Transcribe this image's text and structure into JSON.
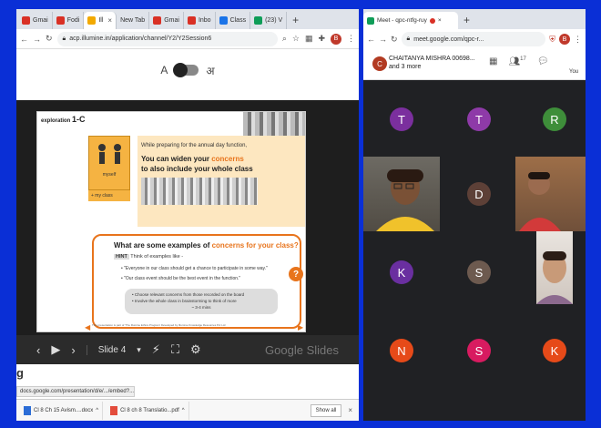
{
  "left_window": {
    "tabs": [
      {
        "label": "Gmai",
        "color": "#d93025"
      },
      {
        "label": "Fodi",
        "color": "#d93025"
      },
      {
        "label": "Ill",
        "color": "#f2a900"
      },
      {
        "label": "New Tab",
        "color": ""
      },
      {
        "label": "Gmai",
        "color": "#d93025"
      },
      {
        "label": "Inbo",
        "color": "#d93025"
      },
      {
        "label": "Class",
        "color": "#1a73e8"
      },
      {
        "label": "(23) V",
        "color": "#0f9d58"
      }
    ],
    "url": "acp.illumine.in/application/channel/Y2/Y2Session6",
    "profile_initial": "B",
    "lang_toggle": {
      "left": "A",
      "right": "अ"
    },
    "slide": {
      "exploration": "exploration",
      "exploration_num": "1-C",
      "myself": "myself",
      "myclass": "+ my class",
      "prep_text": "While preparing for the annual day function,",
      "heading_line1_a": "You can widen your ",
      "heading_line1_b": "concerns",
      "heading_line2": "to also include your whole class",
      "question_a": "What are some examples of ",
      "question_b": "concerns for your class?",
      "hint_label": "HINT",
      "hint_text": "Think of examples like -",
      "bullet1": "\"Everyone in our class should get a chance to participate in some way.\"",
      "bullet2": "\"Our class event should be the best event in the function.\"",
      "grey1": "Choose relevant concerns from those recorded on the board",
      "grey2": "Involve the whole class in brainstorming to think of more",
      "grey3": "~ 3-4 mins",
      "footer": "This presentation is part of 'The Illumine Ethics Program' Developed by Illumine Knowledge Resources Pvt Ltd"
    },
    "controls": {
      "slide_label": "Slide 4",
      "google_slides": "Google Slides"
    },
    "page_caption": "g",
    "status_url": "docs.google.com/presentation/d/e/.../embed?...",
    "downloads": [
      {
        "name": "Cl 8 Ch 15 Avism....docx",
        "kind": "w"
      },
      {
        "name": "Cl 8 ch 8 Translatio...pdf",
        "kind": "p"
      }
    ],
    "show_all": "Show all"
  },
  "right_window": {
    "tab_label": "Meet - qpc-ntfg-ruy",
    "url": "meet.google.com/qpc-r...",
    "caller_initial": "C",
    "caller_name": "CHAITANYA MISHRA 00698...",
    "caller_more": "and 3 more",
    "participant_count": "17",
    "you_label": "You",
    "profile_initial": "B",
    "tiles": [
      {
        "initial": "T",
        "color": "#7b2f9e"
      },
      {
        "initial": "T",
        "color": "#8e3aa8"
      },
      {
        "initial": "R",
        "color": "#3e8e3a"
      },
      {
        "initial": "D",
        "color": "#5d4037"
      },
      {
        "initial": "K",
        "color": "#6a2fa0"
      },
      {
        "initial": "S",
        "color": "#6d5a4f"
      },
      {
        "initial": "N",
        "color": "#e64a19"
      },
      {
        "initial": "S",
        "color": "#d81b60"
      },
      {
        "initial": "K",
        "color": "#e64a19"
      }
    ]
  }
}
